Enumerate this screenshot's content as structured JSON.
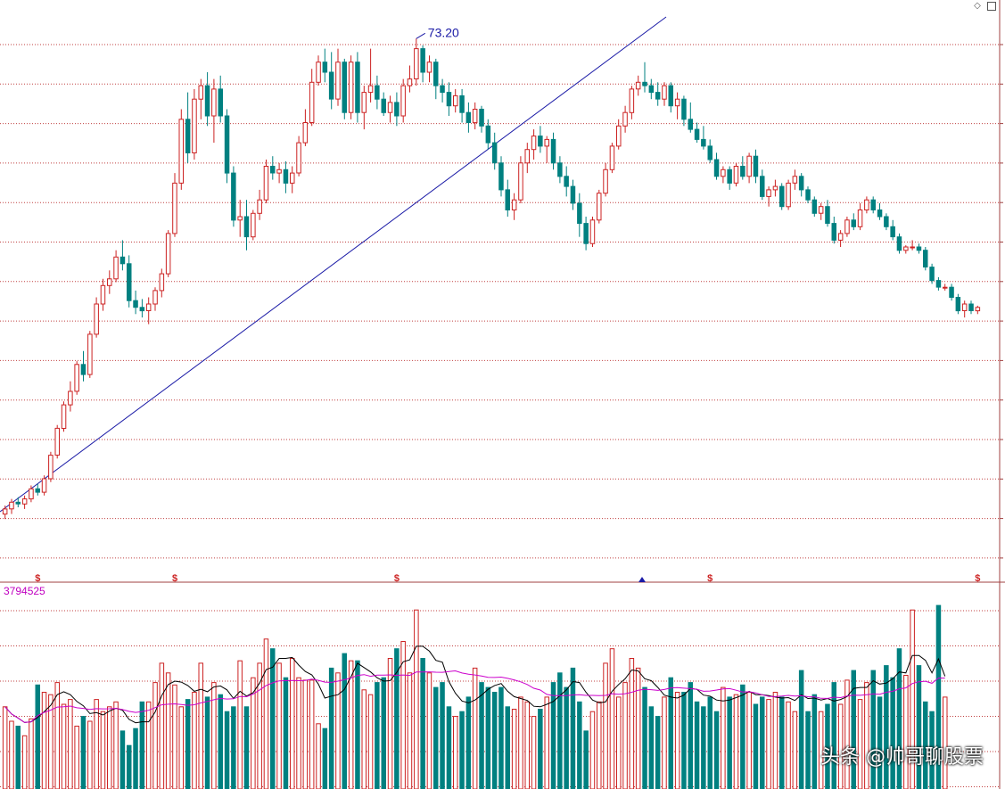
{
  "header": {
    "icons": [
      "diamond-icon",
      "panel-toggle-icon"
    ]
  },
  "price_panel": {
    "peak_label": "73.20",
    "marker_symbol": "$"
  },
  "volume_panel": {
    "readout": "3794525"
  },
  "watermark": "头条 @帅哥聊股票",
  "colors": {
    "up": "#cc2222",
    "down": "#008080",
    "trendline": "#1a1aa6",
    "gridline": "#c04040",
    "ma_short": "#000000",
    "ma_long": "#cc00cc",
    "readout": "#c000c0"
  },
  "chart_data": {
    "type": "candlestick",
    "grid": true,
    "peak_price": 73.2,
    "candles": [
      [
        44.9,
        45.4,
        44.6,
        45.2
      ],
      [
        45.2,
        45.8,
        44.9,
        45.6
      ],
      [
        45.6,
        45.9,
        45.3,
        45.5
      ],
      [
        45.5,
        46.0,
        45.2,
        45.8
      ],
      [
        45.8,
        46.6,
        45.6,
        46.4
      ],
      [
        46.4,
        46.7,
        46.0,
        46.2
      ],
      [
        46.2,
        47.2,
        46.0,
        47.0
      ],
      [
        47.0,
        48.6,
        46.8,
        48.4
      ],
      [
        48.4,
        50.2,
        48.2,
        50.0
      ],
      [
        50.0,
        51.6,
        49.8,
        51.4
      ],
      [
        51.4,
        52.8,
        51.0,
        52.2
      ],
      [
        52.2,
        54.0,
        52.0,
        53.8
      ],
      [
        53.8,
        54.6,
        52.8,
        53.2
      ],
      [
        53.2,
        55.8,
        53.0,
        55.6
      ],
      [
        55.6,
        57.8,
        55.4,
        57.4
      ],
      [
        57.4,
        58.9,
        57.0,
        58.5
      ],
      [
        58.5,
        59.4,
        58.0,
        58.9
      ],
      [
        58.9,
        60.6,
        58.7,
        60.2
      ],
      [
        60.2,
        61.2,
        59.4,
        59.8
      ],
      [
        59.8,
        60.3,
        57.2,
        57.6
      ],
      [
        57.6,
        58.2,
        56.8,
        57.2
      ],
      [
        57.2,
        57.7,
        56.6,
        57.0
      ],
      [
        57.0,
        57.8,
        56.2,
        57.4
      ],
      [
        57.4,
        58.4,
        57.0,
        58.2
      ],
      [
        58.2,
        59.5,
        57.8,
        59.2
      ],
      [
        59.2,
        61.8,
        59.0,
        61.6
      ],
      [
        61.6,
        65.2,
        61.4,
        64.6
      ],
      [
        64.6,
        69.0,
        64.2,
        68.4
      ],
      [
        68.4,
        70.0,
        65.8,
        66.4
      ],
      [
        66.4,
        70.2,
        66.0,
        69.6
      ],
      [
        69.6,
        70.8,
        68.4,
        70.4
      ],
      [
        70.4,
        71.2,
        68.0,
        68.6
      ],
      [
        68.6,
        70.8,
        67.0,
        70.2
      ],
      [
        70.2,
        71.0,
        68.2,
        68.6
      ],
      [
        68.6,
        69.0,
        64.6,
        65.2
      ],
      [
        65.2,
        65.6,
        62.0,
        62.4
      ],
      [
        62.4,
        63.6,
        61.4,
        62.6
      ],
      [
        62.6,
        63.6,
        60.6,
        61.4
      ],
      [
        61.4,
        63.0,
        61.2,
        62.8
      ],
      [
        62.8,
        64.2,
        62.4,
        63.6
      ],
      [
        63.6,
        66.0,
        63.4,
        65.6
      ],
      [
        65.6,
        66.2,
        64.8,
        65.2
      ],
      [
        65.2,
        65.8,
        64.6,
        65.4
      ],
      [
        65.4,
        65.9,
        64.0,
        64.6
      ],
      [
        64.6,
        65.6,
        64.0,
        65.2
      ],
      [
        65.2,
        67.4,
        65.0,
        67.0
      ],
      [
        67.0,
        69.0,
        66.8,
        68.2
      ],
      [
        68.2,
        71.4,
        68.0,
        70.6
      ],
      [
        70.6,
        72.2,
        70.4,
        71.8
      ],
      [
        71.8,
        72.6,
        70.6,
        71.2
      ],
      [
        71.2,
        72.4,
        69.0,
        69.6
      ],
      [
        69.6,
        72.6,
        69.2,
        71.8
      ],
      [
        71.8,
        72.0,
        68.4,
        68.8
      ],
      [
        68.8,
        72.2,
        68.4,
        71.8
      ],
      [
        71.8,
        72.4,
        68.2,
        68.8
      ],
      [
        68.8,
        70.4,
        67.8,
        70.0
      ],
      [
        70.0,
        72.6,
        69.4,
        70.4
      ],
      [
        70.4,
        71.0,
        69.0,
        69.6
      ],
      [
        69.6,
        70.0,
        68.6,
        68.8
      ],
      [
        68.8,
        69.8,
        68.2,
        69.4
      ],
      [
        69.4,
        70.0,
        68.0,
        68.6
      ],
      [
        68.6,
        70.8,
        68.2,
        70.4
      ],
      [
        70.4,
        71.6,
        70.0,
        70.8
      ],
      [
        70.8,
        73.2,
        70.4,
        72.6
      ],
      [
        72.6,
        72.8,
        70.6,
        71.2
      ],
      [
        71.2,
        72.2,
        70.6,
        71.8
      ],
      [
        71.8,
        72.0,
        69.6,
        70.4
      ],
      [
        70.4,
        70.8,
        69.4,
        70.0
      ],
      [
        70.0,
        70.6,
        68.6,
        69.2
      ],
      [
        69.2,
        70.2,
        68.8,
        69.8
      ],
      [
        69.8,
        70.2,
        68.2,
        68.8
      ],
      [
        68.8,
        69.4,
        67.6,
        68.2
      ],
      [
        68.2,
        69.4,
        67.8,
        69.0
      ],
      [
        69.0,
        69.2,
        67.6,
        68.0
      ],
      [
        68.0,
        68.4,
        66.6,
        67.0
      ],
      [
        67.0,
        67.6,
        65.4,
        65.8
      ],
      [
        65.8,
        66.2,
        63.8,
        64.2
      ],
      [
        64.2,
        64.8,
        62.6,
        63.0
      ],
      [
        63.0,
        64.0,
        62.4,
        63.6
      ],
      [
        63.6,
        66.2,
        63.4,
        65.8
      ],
      [
        65.8,
        67.0,
        65.2,
        66.6
      ],
      [
        66.6,
        67.8,
        66.0,
        67.4
      ],
      [
        67.4,
        68.0,
        66.4,
        66.8
      ],
      [
        66.8,
        67.4,
        65.8,
        67.2
      ],
      [
        67.2,
        67.6,
        65.4,
        65.8
      ],
      [
        65.8,
        66.2,
        64.6,
        65.0
      ],
      [
        65.0,
        65.6,
        63.8,
        64.4
      ],
      [
        64.4,
        64.8,
        63.0,
        63.4
      ],
      [
        63.4,
        64.0,
        61.4,
        62.2
      ],
      [
        62.2,
        62.6,
        60.6,
        61.0
      ],
      [
        61.0,
        62.6,
        60.8,
        62.4
      ],
      [
        62.4,
        64.2,
        62.2,
        64.0
      ],
      [
        64.0,
        65.8,
        63.8,
        65.4
      ],
      [
        65.4,
        67.0,
        65.2,
        66.8
      ],
      [
        66.8,
        68.4,
        66.6,
        68.0
      ],
      [
        68.0,
        69.2,
        67.6,
        68.8
      ],
      [
        68.8,
        70.4,
        68.4,
        70.2
      ],
      [
        70.2,
        71.0,
        69.8,
        70.6
      ],
      [
        70.6,
        71.8,
        70.0,
        70.4
      ],
      [
        70.4,
        70.8,
        69.6,
        70.0
      ],
      [
        70.0,
        70.6,
        69.2,
        69.6
      ],
      [
        69.6,
        70.6,
        69.2,
        70.4
      ],
      [
        70.4,
        70.6,
        68.8,
        69.2
      ],
      [
        69.2,
        70.0,
        68.4,
        69.6
      ],
      [
        69.6,
        69.8,
        68.0,
        68.4
      ],
      [
        68.4,
        69.4,
        67.6,
        67.8
      ],
      [
        67.8,
        68.2,
        67.0,
        67.2
      ],
      [
        67.2,
        68.0,
        66.6,
        66.8
      ],
      [
        66.8,
        67.2,
        65.8,
        66.0
      ],
      [
        66.0,
        66.4,
        64.8,
        65.0
      ],
      [
        65.0,
        65.6,
        64.6,
        65.4
      ],
      [
        65.4,
        65.6,
        64.2,
        64.6
      ],
      [
        64.6,
        65.8,
        64.4,
        65.6
      ],
      [
        65.6,
        66.2,
        64.8,
        65.0
      ],
      [
        65.0,
        66.4,
        64.6,
        66.2
      ],
      [
        66.2,
        66.6,
        64.6,
        65.0
      ],
      [
        65.0,
        65.4,
        63.6,
        63.8
      ],
      [
        63.8,
        64.4,
        63.2,
        64.2
      ],
      [
        64.2,
        64.8,
        63.8,
        64.4
      ],
      [
        64.4,
        64.6,
        63.0,
        63.2
      ],
      [
        63.2,
        64.8,
        63.0,
        64.6
      ],
      [
        64.6,
        65.4,
        64.2,
        65.0
      ],
      [
        65.0,
        65.2,
        63.8,
        64.2
      ],
      [
        64.2,
        64.4,
        63.4,
        63.6
      ],
      [
        63.6,
        63.8,
        62.6,
        62.8
      ],
      [
        62.8,
        63.4,
        62.4,
        63.2
      ],
      [
        63.2,
        63.6,
        62.0,
        62.2
      ],
      [
        62.2,
        62.6,
        61.0,
        61.2
      ],
      [
        61.2,
        61.8,
        60.8,
        61.6
      ],
      [
        61.6,
        62.6,
        61.4,
        62.4
      ],
      [
        62.4,
        62.8,
        61.8,
        62.0
      ],
      [
        62.0,
        63.4,
        61.8,
        63.0
      ],
      [
        63.0,
        63.8,
        62.8,
        63.6
      ],
      [
        63.6,
        63.8,
        62.8,
        63.0
      ],
      [
        63.0,
        63.4,
        62.4,
        62.6
      ],
      [
        62.6,
        62.8,
        61.8,
        62.0
      ],
      [
        62.0,
        62.4,
        61.2,
        61.4
      ],
      [
        61.4,
        61.6,
        60.4,
        60.6
      ],
      [
        60.6,
        60.9,
        60.4,
        60.8
      ],
      [
        60.8,
        61.2,
        60.6,
        60.8
      ],
      [
        60.8,
        61.0,
        60.4,
        60.6
      ],
      [
        60.6,
        60.8,
        59.4,
        59.6
      ],
      [
        59.6,
        59.8,
        58.6,
        58.8
      ],
      [
        58.8,
        59.0,
        58.2,
        58.4
      ],
      [
        58.4,
        58.6,
        58.2,
        58.4
      ],
      [
        58.4,
        58.6,
        57.6,
        57.8
      ],
      [
        57.8,
        58.0,
        56.8,
        57.0
      ],
      [
        57.0,
        57.6,
        56.6,
        57.4
      ],
      [
        57.4,
        57.6,
        56.8,
        57.0
      ],
      [
        57.0,
        57.3,
        56.8,
        57.2
      ]
    ],
    "volume": {
      "max": 3794525,
      "values": [
        1700000,
        1400000,
        1300000,
        1100000,
        1450000,
        2150000,
        2000000,
        1950000,
        2200000,
        1750000,
        1850000,
        1300000,
        1500000,
        1400000,
        1850000,
        1600000,
        1700000,
        1800000,
        1200000,
        900000,
        1250000,
        1800000,
        1800000,
        2200000,
        2600000,
        2400000,
        2150000,
        1700000,
        1850000,
        2000000,
        2600000,
        1900000,
        2200000,
        1950000,
        1600000,
        1700000,
        2650000,
        1700000,
        2300000,
        2600000,
        3100000,
        2900000,
        2600000,
        2300000,
        2700000,
        2300000,
        2250000,
        2250000,
        1350000,
        1250000,
        2500000,
        2400000,
        2800000,
        2650000,
        2650000,
        2050000,
        1950000,
        2200000,
        2300000,
        2700000,
        2900000,
        3050000,
        2400000,
        3700000,
        2700000,
        2400000,
        2100000,
        2200000,
        1700000,
        1500000,
        1600000,
        1900000,
        2500000,
        2200000,
        2100000,
        2000000,
        2100000,
        1700000,
        1650000,
        1900000,
        1800000,
        1500000,
        1650000,
        1900000,
        2200000,
        2400000,
        2100000,
        2500000,
        1800000,
        1200000,
        1600000,
        1800000,
        2600000,
        2900000,
        1900000,
        2200000,
        2700000,
        2500000,
        2100000,
        1700000,
        1500000,
        1900000,
        2300000,
        2000000,
        2000000,
        2200000,
        1800000,
        1700000,
        1900000,
        1600000,
        2100000,
        1900000,
        1950000,
        2150000,
        2000000,
        1750000,
        1900000,
        1850000,
        2000000,
        1900000,
        1800000,
        1600000,
        2450000,
        1600000,
        1950000,
        1600000,
        1750000,
        2200000,
        1750000,
        2250000,
        2450000,
        1850000,
        2200000,
        2450000,
        1900000,
        2550000,
        2300000,
        2900000,
        2350000,
        3700000,
        2550000,
        1800000,
        1600000,
        3794525,
        1900000
      ]
    },
    "markers": [
      "$",
      "$",
      "$",
      "$",
      "$"
    ],
    "annotations": [
      "73.20"
    ]
  }
}
